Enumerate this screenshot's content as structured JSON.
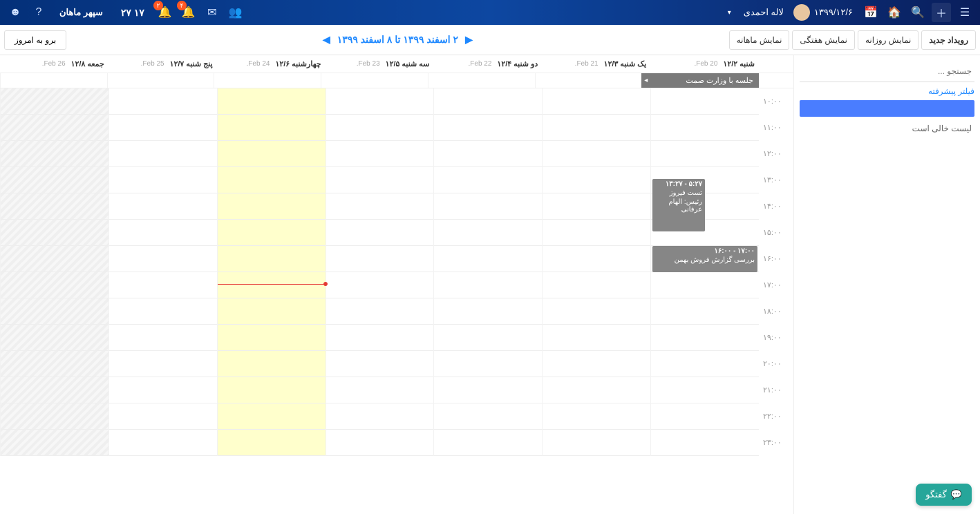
{
  "topbar": {
    "menu_icon_name": "menu-icon",
    "plus_icon_name": "plus-icon",
    "search_icon_name": "search-icon",
    "home_icon_name": "home-icon",
    "cal_icon_name": "calendar-icon",
    "date": "۱۳۹۹/۱۲/۶",
    "username": "لاله احمدی",
    "dropdown_caret": "▾",
    "time": "۱۷ ۲۷",
    "brand": "سپهر ماهان",
    "mail_icon_name": "mail-icon",
    "bell_icon_name": "bell-icon",
    "bell2_icon_name": "bell2-icon",
    "help_icon_name": "help-icon",
    "smile_icon_name": "smile-icon",
    "badge1": "۴",
    "badge2": "۲"
  },
  "toolbar": {
    "new_event": "رویداد جدید",
    "view_day": "نمایش روزانه",
    "view_week": "نمایش هفتگی",
    "view_month": "نمایش ماهانه",
    "date_range": "۲ اسفند ۱۳۹۹ تا ۸ اسفند ۱۳۹۹",
    "today": "برو به امروز"
  },
  "sidebar": {
    "search_placeholder": "جستجو ...",
    "filter": "فیلتر پیشرفته",
    "empty": "لیست خالی است"
  },
  "days": [
    {
      "persian": "شنبه ۱۲/۲",
      "greg": "20 Feb."
    },
    {
      "persian": "یک شنبه ۱۲/۳",
      "greg": "21 Feb."
    },
    {
      "persian": "دو شنبه ۱۲/۴",
      "greg": "22 Feb."
    },
    {
      "persian": "سه شنبه ۱۲/۵",
      "greg": "23 Feb."
    },
    {
      "persian": "چهارشنبه ۱۲/۶",
      "greg": "24 Feb."
    },
    {
      "persian": "پنج شنبه ۱۲/۷",
      "greg": "25 Feb."
    },
    {
      "persian": "جمعه ۱۲/۸",
      "greg": "26 Feb."
    }
  ],
  "allday": {
    "title": "جلسه با وزارت صمت"
  },
  "hours": [
    "۱۰:۰۰",
    "۱۱:۰۰",
    "۱۲:۰۰",
    "۱۳:۰۰",
    "۱۴:۰۰",
    "۱۵:۰۰",
    "۱۶:۰۰",
    "۱۷:۰۰",
    "۱۸:۰۰",
    "۱۹:۰۰",
    "۲۰:۰۰",
    "۲۱:۰۰",
    "۲۲:۰۰",
    "۲۳:۰۰"
  ],
  "events": {
    "e1": {
      "time": "۱۳:۲۷ - ۵:۲۷",
      "line1": "تست فیروز",
      "line2": "رئیس: الهام عرفانی"
    },
    "e2": {
      "time": "۱۶:۰۰ - ۱۷:۰۰",
      "line1": "بررسی گزارش فروش بهمن"
    }
  },
  "chat": "گفتگو"
}
